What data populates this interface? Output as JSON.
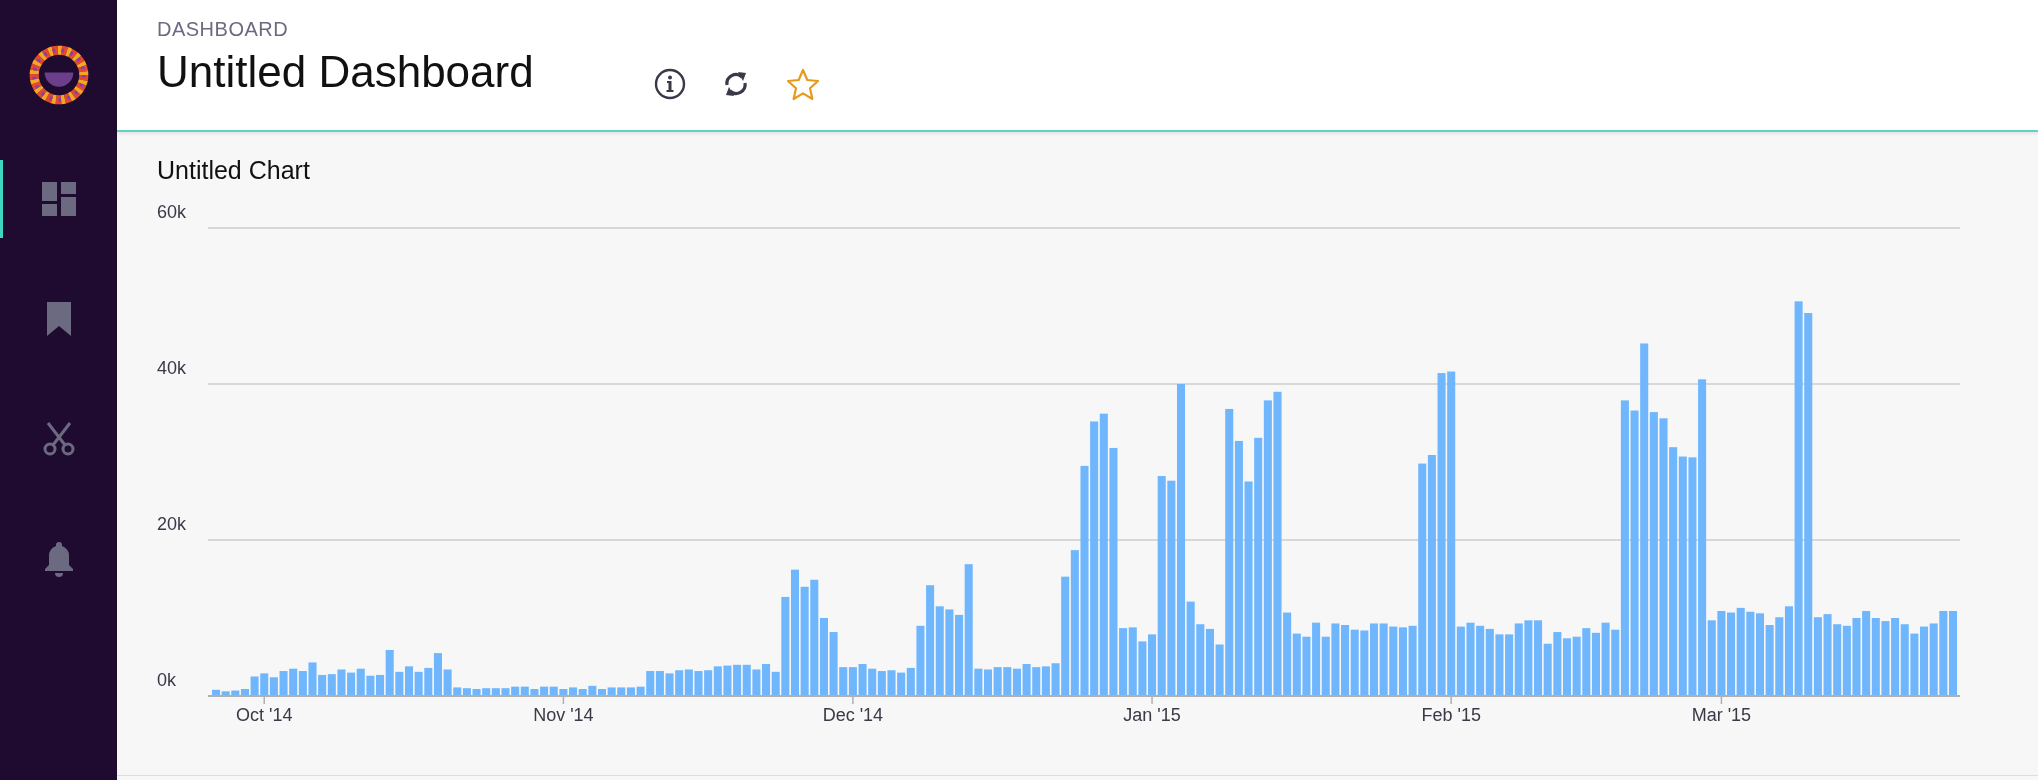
{
  "sidebar": {
    "items": [
      {
        "kind": "dashboard",
        "selected": true
      },
      {
        "kind": "bookmark",
        "selected": false
      },
      {
        "kind": "scissors",
        "selected": false
      },
      {
        "kind": "bell",
        "selected": false
      }
    ]
  },
  "header": {
    "breadcrumb": "DASHBOARD",
    "title": "Untitled Dashboard",
    "actions": [
      {
        "kind": "info"
      },
      {
        "kind": "refresh"
      },
      {
        "kind": "star"
      }
    ]
  },
  "chart": {
    "chart_data": {
      "type": "bar",
      "title": "Untitled Chart",
      "categories": [
        null,
        null,
        null,
        null,
        null,
        "Oct '14",
        null,
        null,
        null,
        null,
        null,
        null,
        null,
        null,
        null,
        null,
        null,
        null,
        null,
        null,
        null,
        null,
        null,
        null,
        null,
        null,
        null,
        null,
        null,
        null,
        null,
        null,
        null,
        null,
        null,
        null,
        "Nov '14",
        null,
        null,
        null,
        null,
        null,
        null,
        null,
        null,
        null,
        null,
        null,
        null,
        null,
        null,
        null,
        null,
        null,
        null,
        null,
        null,
        null,
        null,
        null,
        null,
        null,
        null,
        null,
        null,
        null,
        "Dec '14",
        null,
        null,
        null,
        null,
        null,
        null,
        null,
        null,
        null,
        null,
        null,
        null,
        null,
        null,
        null,
        null,
        null,
        null,
        null,
        null,
        null,
        null,
        null,
        null,
        null,
        null,
        null,
        null,
        null,
        null,
        "Jan '15",
        null,
        null,
        null,
        null,
        null,
        null,
        null,
        null,
        null,
        null,
        null,
        null,
        null,
        null,
        null,
        null,
        null,
        null,
        null,
        null,
        null,
        null,
        null,
        null,
        null,
        null,
        null,
        null,
        null,
        null,
        "Feb '15",
        null,
        null,
        null,
        null,
        null,
        null,
        null,
        null,
        null,
        null,
        null,
        null,
        null,
        null,
        null,
        null,
        null,
        null,
        null,
        null,
        null,
        null,
        null,
        null,
        null,
        null,
        null,
        "Mar '15",
        null,
        null,
        null,
        null,
        null,
        null,
        null,
        null,
        null,
        null,
        null,
        null,
        null,
        null,
        null,
        null,
        null,
        null,
        null,
        null,
        null,
        null,
        null,
        null
      ],
      "values": [
        800,
        600,
        700,
        900,
        2500,
        2900,
        2400,
        3200,
        3500,
        3200,
        4300,
        2700,
        2800,
        3400,
        3000,
        3500,
        2600,
        2700,
        5900,
        3100,
        3800,
        3100,
        3600,
        5500,
        3400,
        1100,
        1000,
        900,
        1000,
        1000,
        1000,
        1200,
        1200,
        900,
        1200,
        1200,
        900,
        1100,
        900,
        1300,
        900,
        1100,
        1100,
        1100,
        1200,
        3200,
        3200,
        2900,
        3300,
        3400,
        3200,
        3300,
        3800,
        3900,
        4000,
        4000,
        3400,
        4100,
        3100,
        12700,
        16200,
        14000,
        14900,
        10000,
        8200,
        3700,
        3700,
        4100,
        3500,
        3200,
        3300,
        3000,
        3600,
        9000,
        14200,
        11500,
        11100,
        10400,
        16900,
        3500,
        3400,
        3700,
        3700,
        3500,
        4100,
        3700,
        3800,
        4200,
        15300,
        18700,
        29500,
        35200,
        36200,
        31800,
        8700,
        8800,
        7000,
        7900,
        28200,
        27600,
        40000,
        12100,
        9200,
        8600,
        6600,
        36800,
        32700,
        27500,
        33100,
        37900,
        39000,
        10700,
        8000,
        7600,
        9400,
        7600,
        9300,
        9100,
        8500,
        8400,
        9300,
        9300,
        8900,
        8800,
        9000,
        29800,
        30900,
        41400,
        41600,
        8900,
        9400,
        9000,
        8600,
        7900,
        7900,
        9300,
        9700,
        9700,
        6700,
        8200,
        7400,
        7600,
        8700,
        8100,
        9400,
        8500,
        37900,
        36600,
        45200,
        36400,
        35600,
        31900,
        30700,
        30600,
        40600,
        9700,
        10900,
        10700,
        11300,
        10800,
        10600,
        9100,
        10100,
        11500,
        50600,
        49100,
        10100,
        10500,
        9200,
        9000,
        10000,
        10900,
        10000,
        9600,
        10000,
        9200,
        8000,
        8900,
        9300,
        10900,
        10900
      ],
      "ylim": [
        0,
        60000
      ],
      "yticks": [
        {
          "value": 0,
          "label": "0k"
        },
        {
          "value": 20000,
          "label": "20k"
        },
        {
          "value": 40000,
          "label": "40k"
        },
        {
          "value": 60000,
          "label": "60k"
        }
      ]
    }
  }
}
